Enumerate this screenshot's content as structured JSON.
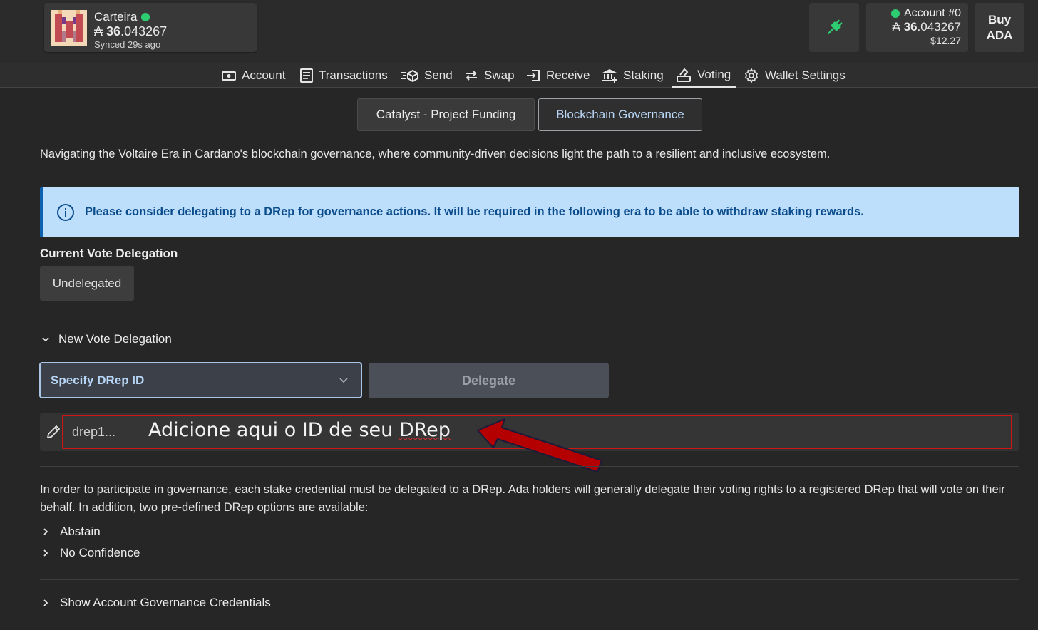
{
  "wallet": {
    "name": "Carteira",
    "currency_symbol": "₳",
    "balance_int": "36",
    "balance_dec": ".043267",
    "synced": "Synced 29s ago",
    "status_color": "#2ecc71"
  },
  "account": {
    "name": "Account #0",
    "currency_symbol": "₳",
    "balance_int": "36",
    "balance_dec": ".043267",
    "usd": "$12.27"
  },
  "buy": {
    "line1": "Buy",
    "line2": "ADA"
  },
  "nav": [
    {
      "label": "Account",
      "icon": "account-icon"
    },
    {
      "label": "Transactions",
      "icon": "list-icon"
    },
    {
      "label": "Send",
      "icon": "send-icon"
    },
    {
      "label": "Swap",
      "icon": "swap-icon"
    },
    {
      "label": "Receive",
      "icon": "receive-icon"
    },
    {
      "label": "Staking",
      "icon": "bank-icon"
    },
    {
      "label": "Voting",
      "icon": "vote-icon",
      "active": true
    },
    {
      "label": "Wallet Settings",
      "icon": "gear-icon"
    }
  ],
  "subtabs": [
    "Catalyst - Project Funding",
    "Blockchain Governance"
  ],
  "intro": "Navigating the Voltaire Era in Cardano's blockchain governance, where community-driven decisions light the path to a resilient and inclusive ecosystem.",
  "alert": "Please consider delegating to a DRep for governance actions. It will be required in the following era to be able to withdraw staking rewards.",
  "current": {
    "label": "Current Vote Delegation",
    "value": "Undelegated"
  },
  "new_delegation": {
    "label": "New Vote Delegation",
    "select_value": "Specify DRep ID",
    "delegate_label": "Delegate",
    "placeholder": "drep1...",
    "annotation_main": "Adicione aqui o ID de seu ",
    "annotation_word": "DRep"
  },
  "paragraph": "In order to participate in governance, each stake credential must be delegated to a DRep. Ada holders will generally delegate their voting rights to a registered DRep that will vote on their behalf. In addition, two pre-defined DRep options are available:",
  "options": [
    "Abstain",
    "No Confidence"
  ],
  "credentials": "Show Account Governance Credentials",
  "colors": {
    "accent_blue": "#0c61b0",
    "alert_bg": "#bedffb",
    "highlight_red": "#d01414"
  }
}
